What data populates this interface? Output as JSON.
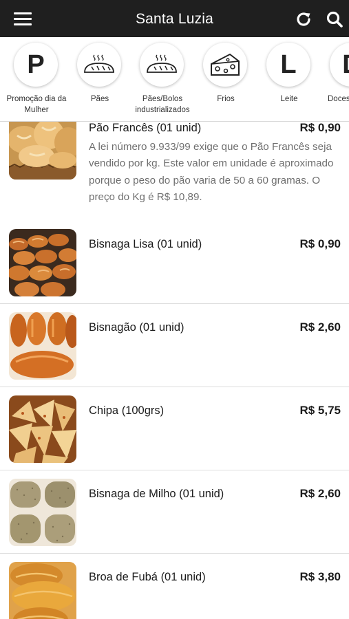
{
  "header": {
    "title": "Santa Luzia",
    "menu_icon": "hamburger-menu-icon",
    "refresh_icon": "refresh-icon",
    "search_icon": "search-icon"
  },
  "categories": [
    {
      "letter": "P",
      "label": "Promoção dia da Mulher",
      "icon": "letter-P"
    },
    {
      "letter": "",
      "label": "Pães",
      "icon": "bread-icon"
    },
    {
      "letter": "",
      "label": "Pães/Bolos industrializados",
      "icon": "bread-icon"
    },
    {
      "letter": "",
      "label": "Frios",
      "icon": "cheese-icon"
    },
    {
      "letter": "L",
      "label": "Leite",
      "icon": "letter-L"
    },
    {
      "letter": "D",
      "label": "Doces",
      "icon": "letter-D"
    }
  ],
  "products": [
    {
      "name": "Pão Francês (01 unid)",
      "price": "R$ 0,90",
      "description": "A lei número 9.933/99 exige que o Pão Francês seja vendido por kg. Este valor em unidade é aproximado porque o peso do pão varia de 50 a 60 gramas. O preço do Kg é R$ 10,89."
    },
    {
      "name": "Bisnaga Lisa (01 unid)",
      "price": "R$ 0,90",
      "description": ""
    },
    {
      "name": "Bisnagão (01 unid)",
      "price": "R$ 2,60",
      "description": ""
    },
    {
      "name": "Chipa (100grs)",
      "price": "R$ 5,75",
      "description": ""
    },
    {
      "name": "Bisnaga de Milho (01 unid)",
      "price": "R$ 2,60",
      "description": ""
    },
    {
      "name": "Broa de Fubá (01 unid)",
      "price": "R$ 3,80",
      "description": ""
    }
  ],
  "colors": {
    "topbar": "#1f1f1f",
    "divider": "#dcdcdc",
    "description_text": "#6f6f6f"
  }
}
